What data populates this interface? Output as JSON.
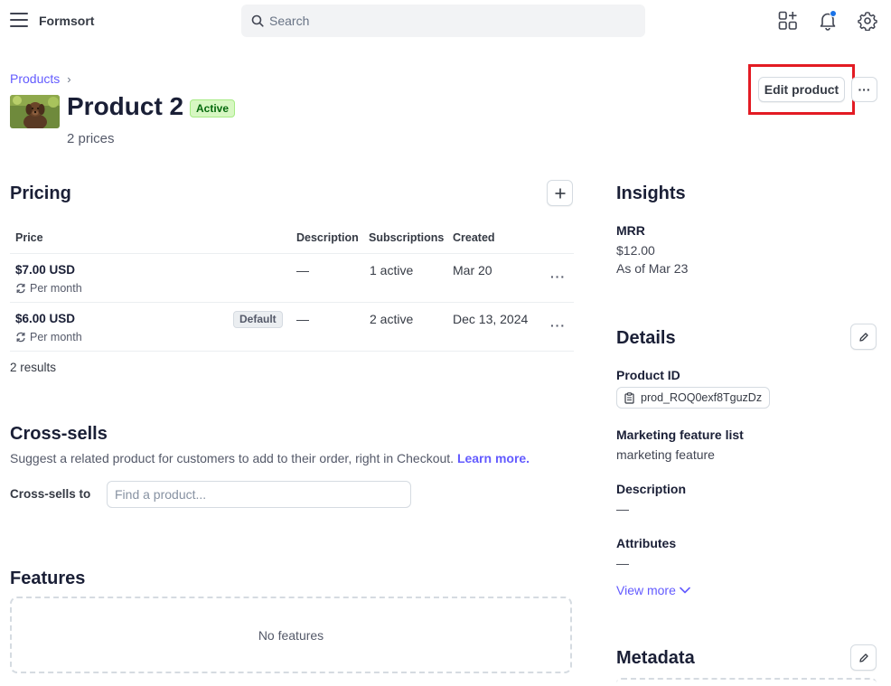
{
  "topbar": {
    "brand": "Formsort",
    "search_placeholder": "Search"
  },
  "header": {
    "breadcrumb": "Products",
    "title": "Product 2",
    "status": "Active",
    "subtitle": "2 prices",
    "edit_label": "Edit product",
    "more_label": "···"
  },
  "pricing": {
    "heading": "Pricing",
    "columns": [
      "Price",
      "Description",
      "Subscriptions",
      "Created"
    ],
    "rows": [
      {
        "price": "$7.00 USD",
        "interval": "Per month",
        "badge": "",
        "description": "—",
        "subscriptions": "1 active",
        "created": "Mar 20"
      },
      {
        "price": "$6.00 USD",
        "interval": "Per month",
        "badge": "Default",
        "description": "—",
        "subscriptions": "2 active",
        "created": "Dec 13, 2024"
      }
    ],
    "results": "2 results"
  },
  "cross_sells": {
    "heading": "Cross-sells",
    "description": "Suggest a related product for customers to add to their order, right in Checkout.",
    "learn_more": "Learn more.",
    "field_label": "Cross-sells to",
    "placeholder": "Find a product..."
  },
  "features": {
    "heading": "Features",
    "empty": "No features"
  },
  "insights": {
    "heading": "Insights",
    "mrr_label": "MRR",
    "mrr_value": "$12.00",
    "mrr_as_of": "As of Mar 23"
  },
  "details": {
    "heading": "Details",
    "product_id_label": "Product ID",
    "product_id": "prod_ROQ0exf8TguzDz",
    "marketing_label": "Marketing feature list",
    "marketing_value": "marketing feature",
    "description_label": "Description",
    "description_value": "—",
    "attributes_label": "Attributes",
    "attributes_value": "—",
    "view_more": "View more"
  },
  "metadata": {
    "heading": "Metadata"
  },
  "colors": {
    "accent": "#635bff",
    "active_badge_bg": "#d7f7c2",
    "highlight": "#e31b23",
    "notification_dot": "#1a73e8"
  }
}
